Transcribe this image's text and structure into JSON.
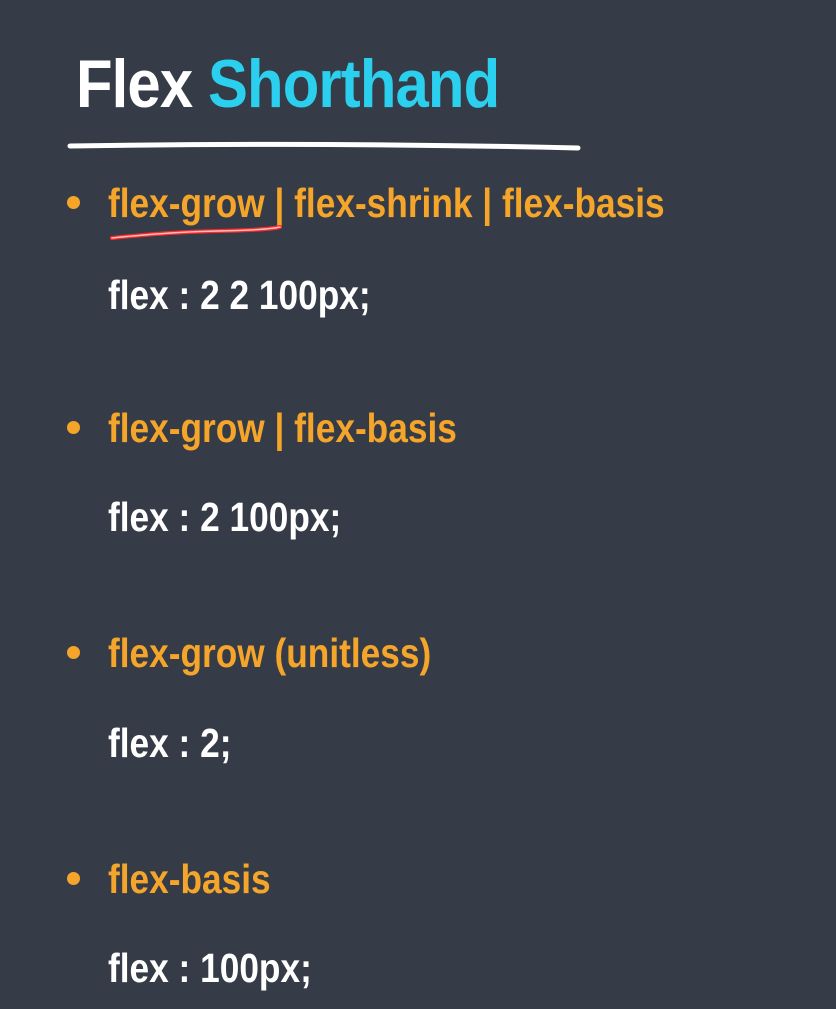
{
  "slide": {
    "title_part1": "Flex",
    "title_part2": "Shorthand",
    "colors": {
      "background": "#363c47",
      "title_primary": "#ffffff",
      "title_accent": "#2bd0ef",
      "bullet_heading": "#f4a52a",
      "code_text": "#ffffff",
      "annotation_stroke": "#ff2a2a"
    },
    "items": [
      {
        "heading": "flex-grow | flex-shrink | flex-basis",
        "code": "flex : 2 2 100px;"
      },
      {
        "heading": "flex-grow | flex-basis",
        "code": "flex : 2 100px;"
      },
      {
        "heading": "flex-grow (unitless)",
        "code": "flex : 2;"
      },
      {
        "heading": "flex-basis",
        "code": "flex : 100px;"
      }
    ]
  }
}
